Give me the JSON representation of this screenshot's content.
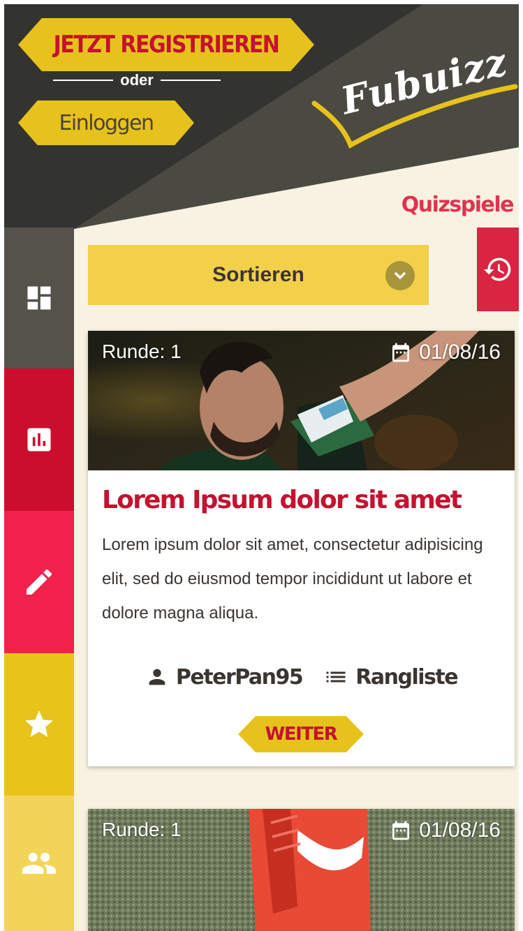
{
  "header": {
    "register_label": "JETZT REGISTRIEREN",
    "or_label": "oder",
    "login_label": "Einloggen",
    "logo_text": "Fubuizz",
    "section_title": "Quizspiele"
  },
  "sidebar": {
    "items": [
      {
        "icon": "dashboard-icon",
        "color": "#55524b"
      },
      {
        "icon": "chart-icon",
        "color": "#cc0e2e"
      },
      {
        "icon": "pencil-icon",
        "color": "#f0224c"
      },
      {
        "icon": "star-icon",
        "color": "#e8c31a"
      },
      {
        "icon": "group-icon",
        "color": "#f2d556"
      }
    ]
  },
  "sort": {
    "label": "Sortieren"
  },
  "cards": [
    {
      "round": "Runde: 1",
      "date": "01/08/16",
      "title": "Lorem Ipsum dolor sit amet",
      "text": "Lorem ipsum dolor sit amet, consectetur adipisicing elit, sed do eiusmod tempor incididunt ut labore et dolore magna aliqua.",
      "user": "PeterPan95",
      "ranking": "Rangliste",
      "continue": "WEITER"
    },
    {
      "round": "Runde: 1",
      "date": "01/08/16"
    }
  ],
  "colors": {
    "header_dark": "#333330",
    "accent_yellow": "#e8c21c",
    "accent_red": "#c4122f",
    "background": "#f7f2e1"
  }
}
